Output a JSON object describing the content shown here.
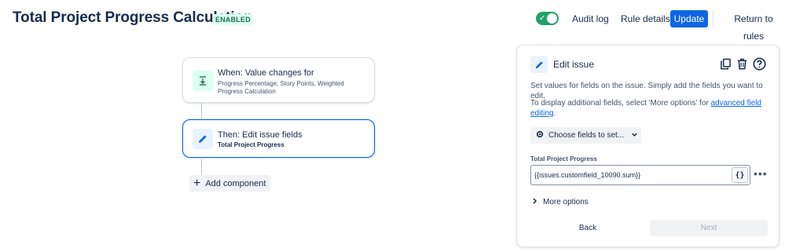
{
  "header": {
    "title": "Total Project Progress Calculation",
    "status": "ENABLED",
    "toggle_state": "on",
    "audit_log": "Audit log",
    "rule_details": "Rule details",
    "update": "Update",
    "return_to_rules": "Return to rules"
  },
  "flow": {
    "trigger": {
      "title": "When: Value changes for",
      "subtitle": "Progress Percentage, Story Points, Weighted Progress Calculation",
      "icon": "value-changed-icon"
    },
    "action": {
      "title": "Then: Edit issue fields",
      "subtitle": "Total Project Progress",
      "icon": "pencil-icon"
    },
    "add_component": "Add component"
  },
  "panel": {
    "title": "Edit issue",
    "description": "Set values for fields on the issue. Simply add the fields you want to edit.",
    "hint_prefix": "To display additional fields, select 'More options' for ",
    "hint_link": "advanced field editing",
    "hint_suffix": ".",
    "choose_fields": "Choose fields to set...",
    "field_label": "Total Project Progress",
    "field_value": "{{issues.customfield_10090.sum}}",
    "smart_value_label": "{}",
    "more_options": "More options",
    "back": "Back",
    "next": "Next"
  },
  "colors": {
    "primary": "#0c66e4",
    "toggle_on": "#22a06b",
    "enabled_text": "#216e4e",
    "trigger_icon_bg": "#dcfff1"
  }
}
